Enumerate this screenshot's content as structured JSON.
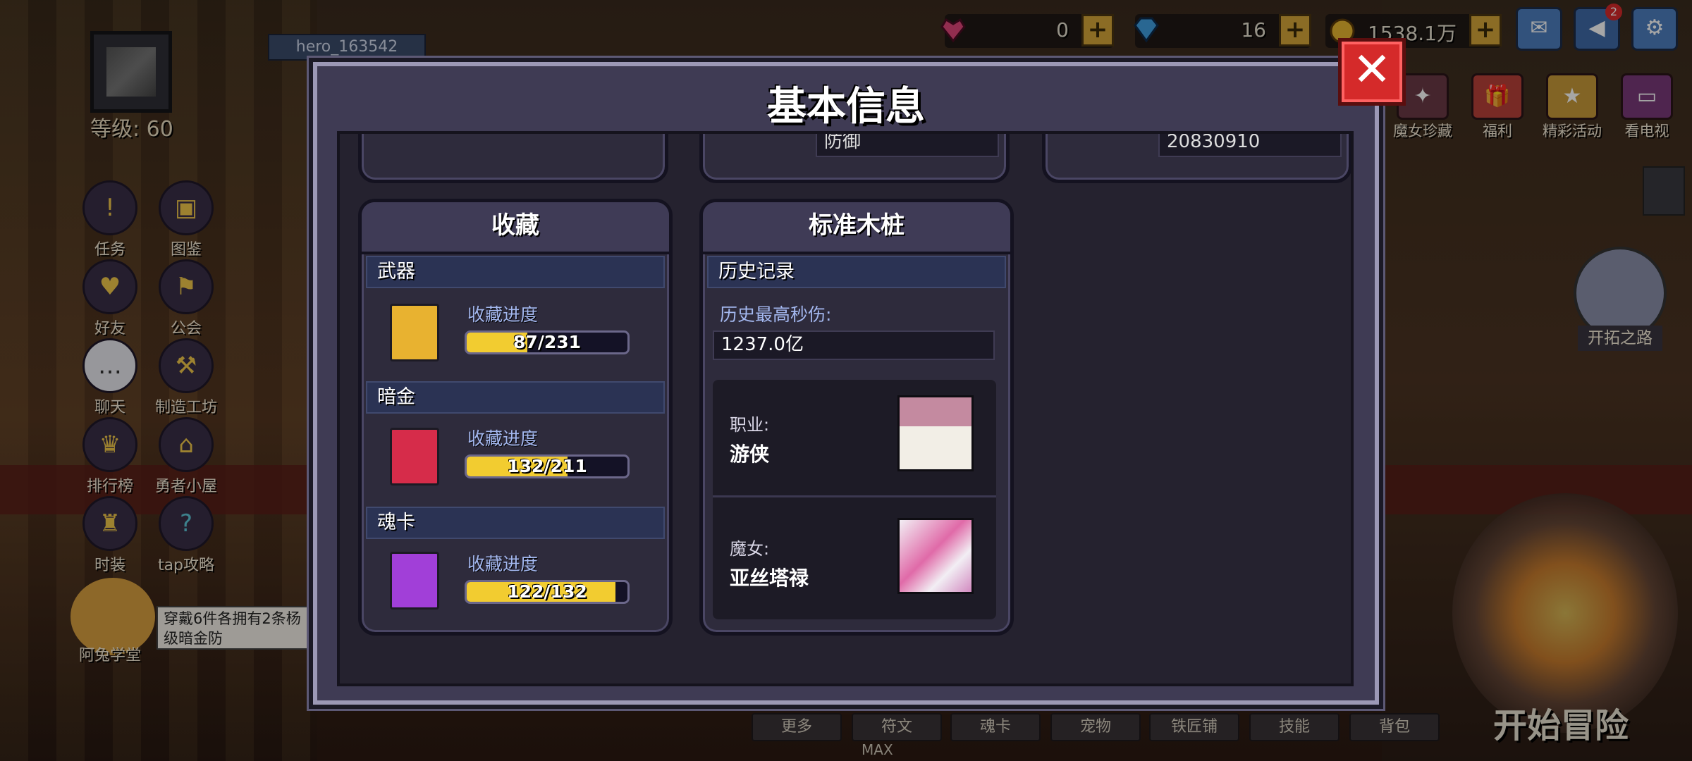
{
  "top_bar": {
    "username": "hero_163542",
    "level_text": "等级: 60",
    "resources": [
      {
        "name": "heart-gem",
        "value": "0"
      },
      {
        "name": "diamond",
        "value": "16"
      },
      {
        "name": "gold",
        "value": "1538.1万"
      }
    ],
    "plus_label": "+",
    "mail_badge": "2"
  },
  "left_menu": [
    {
      "label": "任务",
      "icon": "task-scroll-icon"
    },
    {
      "label": "图鉴",
      "icon": "codex-icon"
    },
    {
      "label": "好友",
      "icon": "friends-icon"
    },
    {
      "label": "公会",
      "icon": "guild-icon"
    },
    {
      "label": "聊天",
      "icon": "chat-icon"
    },
    {
      "label": "制造工坊",
      "icon": "workshop-icon"
    },
    {
      "label": "排行榜",
      "icon": "trophy-icon"
    },
    {
      "label": "勇者小屋",
      "icon": "house-icon"
    },
    {
      "label": "时装",
      "icon": "costume-icon"
    },
    {
      "label": "tap攻略",
      "icon": "guide-icon"
    }
  ],
  "promo": {
    "text": "穿戴6件各拥有2条杨 级暗金防",
    "mascot_label": "阿兔学堂"
  },
  "right_menu": [
    {
      "label": "魔女珍藏"
    },
    {
      "label": "福利"
    },
    {
      "label": "精彩活动"
    },
    {
      "label": "看电视"
    }
  ],
  "right_extra": {
    "explore_label": "开拓之路"
  },
  "bottom_nav": [
    "更多",
    "符文",
    "魂卡",
    "宠物",
    "铁匠铺",
    "技能",
    "背包"
  ],
  "start_label": "开始冒险",
  "max_label": "MAX",
  "modal": {
    "title": "基本信息",
    "close": "✕",
    "top_row_values": [
      "防御",
      "20830910"
    ],
    "collection": {
      "title": "收藏",
      "sections": [
        {
          "name": "武器",
          "label": "收藏进度",
          "text": "87/231",
          "progress": 0.3766,
          "color": "#e8b230"
        },
        {
          "name": "暗金",
          "label": "收藏进度",
          "text": "132/211",
          "progress": 0.6256,
          "color": "#d62c4a"
        },
        {
          "name": "魂卡",
          "label": "收藏进度",
          "text": "122/132",
          "progress": 0.9242,
          "color": "#a13fd8"
        }
      ]
    },
    "dummy": {
      "title": "标准木桩",
      "history_header": "历史记录",
      "max_dps_label": "历史最高秒伤:",
      "max_dps_value": "1237.0亿",
      "class_label": "职业:",
      "class_value": "游侠",
      "witch_label": "魔女:",
      "witch_value": "亚丝塔禄"
    }
  }
}
